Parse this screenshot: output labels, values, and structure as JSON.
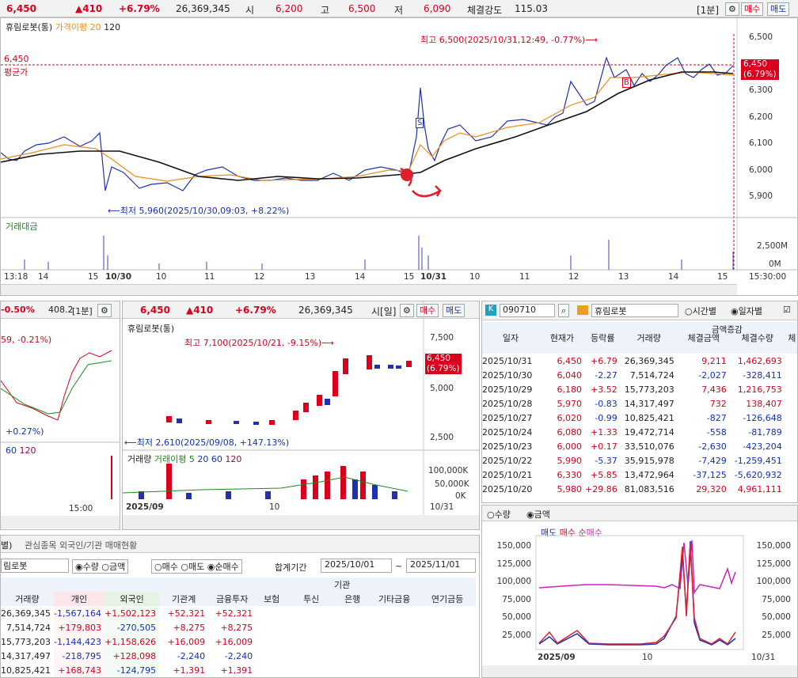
{
  "top": {
    "price": "6,450",
    "change": "▲410",
    "rate": "+6.79%",
    "volume": "26,369,345",
    "open_label": "시",
    "open": "6,200",
    "high_label": "고",
    "high": "6,500",
    "low_label": "저",
    "low": "6,090",
    "strength_label": "체결강도",
    "strength": "115.03",
    "period": "[1분]",
    "buy": "매수",
    "sell": "매도"
  },
  "main": {
    "title": "휴림로봇(통)",
    "ma_label": "가격이평 20",
    "ma120": "120",
    "avg_price": "6,450",
    "avg_label": "평균가",
    "high_note": "최고 6,500(2025/10/31,12:49, -0.77%)⟶",
    "low_note": "⟵최저 5,960(2025/10/30,09:03, +8.22%)",
    "price_tag": "6,450",
    "price_tag_rate": "(6.79%)",
    "sell_marker": "S",
    "buy_marker": "B",
    "yticks": [
      "6,500",
      "6,400",
      "6,300",
      "6,200",
      "6,100",
      "6,000",
      "5,900"
    ],
    "volume_label": "거래대금",
    "vol_ticks": [
      "2,500M",
      "0M"
    ],
    "xlabels": [
      "13:18",
      "14",
      "15",
      "10/30",
      "10",
      "11",
      "12",
      "13",
      "14",
      "15",
      "10/31",
      "10",
      "11",
      "12",
      "13",
      "14",
      "15",
      "15:30:00"
    ]
  },
  "mid_left": {
    "rate": "-0.50%",
    "price": "408.2",
    "period": "[1분]",
    "note1": "59, -0.21%)",
    "note2": "+0.27%)",
    "leg1": "60",
    "leg2": "120",
    "time": "15:00"
  },
  "mid": {
    "price": "6,450",
    "change": "▲410",
    "rate": "+6.79%",
    "volume": "26,369,345",
    "period": "시[일]",
    "buy": "매수",
    "sell": "매도",
    "title": "휴림로봇(통)",
    "high_note": "최고 7,100(2025/10/21, -9.15%)⟶",
    "low_note": "⟵최저 2,610(2025/09/08, +147.13%)",
    "price_tag": "6,450",
    "price_tag_rate": "(6.79%)",
    "yticks": [
      "7,500",
      "5,000",
      "2,500"
    ],
    "vol_label": "거래량",
    "vol_ma": "거래이평 5",
    "ma20": "20",
    "ma60": "60",
    "ma120": "120",
    "vol_ticks": [
      "100,000K",
      "50,000K",
      "0K"
    ],
    "x_start": "2025/09",
    "x_mid": "10",
    "x_end": "10/31"
  },
  "right": {
    "code": "090710",
    "name": "휴림로봇",
    "opt_time": "시간별",
    "opt_day": "일자별",
    "headers": [
      "일자",
      "현재가",
      "등락률",
      "거래량",
      "금액증감",
      "체결금액",
      "체결수량",
      "체"
    ],
    "rows": [
      [
        "2025/10/31",
        "6,450",
        "+6.79",
        "26,369,345",
        "9,211",
        "1,462,693"
      ],
      [
        "2025/10/30",
        "6,040",
        "-2.27",
        "7,514,724",
        "-2,027",
        "-328,411"
      ],
      [
        "2025/10/29",
        "6,180",
        "+3.52",
        "15,773,203",
        "7,436",
        "1,216,753"
      ],
      [
        "2025/10/28",
        "5,970",
        "-0.83",
        "14,317,497",
        "732",
        "138,407"
      ],
      [
        "2025/10/27",
        "6,020",
        "-0.99",
        "10,825,421",
        "-827",
        "-126,648"
      ],
      [
        "2025/10/24",
        "6,080",
        "+1.33",
        "19,472,714",
        "-558",
        "-81,789"
      ],
      [
        "2025/10/23",
        "6,000",
        "+0.17",
        "33,510,076",
        "-2,630",
        "-423,204"
      ],
      [
        "2025/10/22",
        "5,990",
        "-5.37",
        "35,915,978",
        "-7,429",
        "-1,259,451"
      ],
      [
        "2025/10/21",
        "6,330",
        "+5.85",
        "13,472,964",
        "-37,125",
        "-5,620,932"
      ],
      [
        "2025/10/20",
        "5,980",
        "+29.86",
        "81,083,516",
        "29,320",
        "4,961,111"
      ]
    ],
    "opt_qty": "수량",
    "opt_amt": "금액",
    "leg_sell": "매도",
    "leg_buy": "매수",
    "leg_net": "순매수",
    "yticks": [
      "150,000",
      "125,000",
      "100,000",
      "75,000",
      "50,000",
      "25,000"
    ],
    "x_start": "2025/09",
    "x_mid": "10",
    "x_end": "10/31"
  },
  "bottom": {
    "tab1": "별)",
    "tab2": "관심종목 외국인/기관 매매현황",
    "name": "림로봇",
    "opts": [
      "수량",
      "금액",
      "매수",
      "매도",
      "순매수"
    ],
    "period_label": "합계기간",
    "from": "2025/10/01",
    "to": "2025/11/01",
    "inst_label": "기관",
    "headers": [
      "거래량",
      "개인",
      "외국인",
      "기관계",
      "금융투자",
      "보험",
      "투신",
      "은행",
      "기타금융",
      "연기금등"
    ],
    "rows": [
      [
        "26,369,345",
        "-1,567,164",
        "+1,502,123",
        "+52,321",
        "+52,321"
      ],
      [
        "7,514,724",
        "+179,803",
        "-270,505",
        "+8,275",
        "+8,275"
      ],
      [
        "15,773,203",
        "-1,144,423",
        "+1,158,626",
        "+16,009",
        "+16,009"
      ],
      [
        "14,317,497",
        "-218,795",
        "+128,098",
        "-2,240",
        "-2,240"
      ],
      [
        "10,825,421",
        "+168,743",
        "-124,795",
        "+1,391",
        "+1,391"
      ]
    ]
  }
}
